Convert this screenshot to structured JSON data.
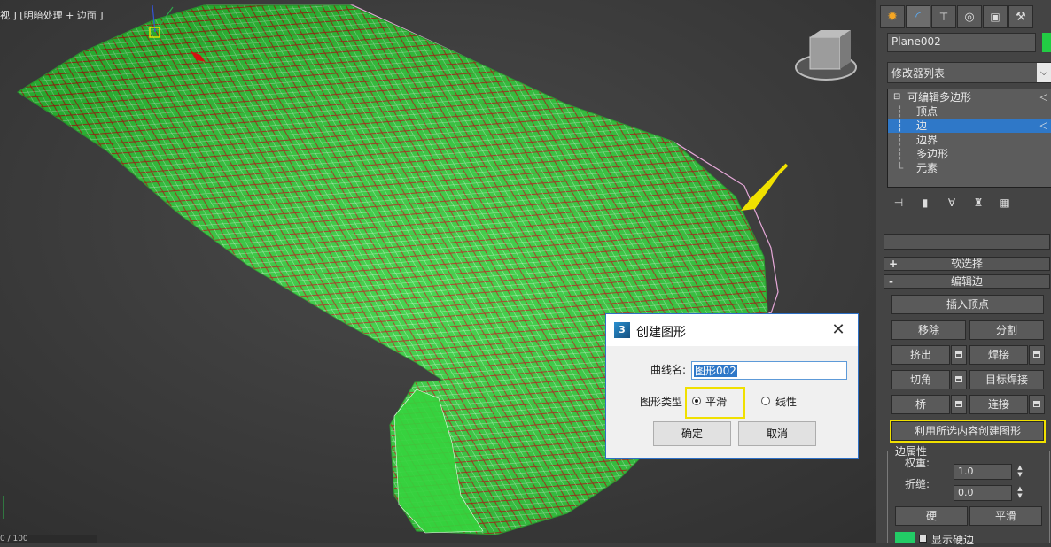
{
  "viewport": {
    "label": "视 ] [明暗处理 + 边面 ]",
    "bottom_text": "0 / 100"
  },
  "dialog": {
    "title": "创建图形",
    "curve_name_label": "曲线名:",
    "curve_name_value": "图形002",
    "shape_type_label": "图形类型",
    "option_smooth": "平滑",
    "option_linear": "线性",
    "selected_option": "平滑",
    "ok_label": "确定",
    "cancel_label": "取消"
  },
  "panel": {
    "object_name": "Plane002",
    "object_color": "#22cc44",
    "modifier_list": "修改器列表",
    "stack": {
      "root": "可编辑多边形",
      "items": [
        "顶点",
        "边",
        "边界",
        "多边形",
        "元素"
      ],
      "selected": "边"
    },
    "rollouts": {
      "soft_selection": "软选择",
      "edit_edges": "编辑边"
    },
    "buttons": {
      "insert_vertex": "插入顶点",
      "remove": "移除",
      "split": "分割",
      "extrude": "挤出",
      "weld": "焊接",
      "chamfer": "切角",
      "target_weld": "目标焊接",
      "bridge": "桥",
      "connect": "连接",
      "create_shape": "利用所选内容创建图形",
      "hard": "硬",
      "smooth": "平滑"
    },
    "edge_props": {
      "group_title": "边属性",
      "weight_label": "权重:",
      "weight_value": "1.0",
      "crease_label": "折缝:",
      "crease_value": "0.0",
      "show_hard_edges": "显示硬边"
    },
    "tab_icons": [
      "create-icon",
      "modify-icon",
      "hierarchy-icon",
      "motion-icon",
      "display-icon",
      "utilities-icon"
    ]
  }
}
